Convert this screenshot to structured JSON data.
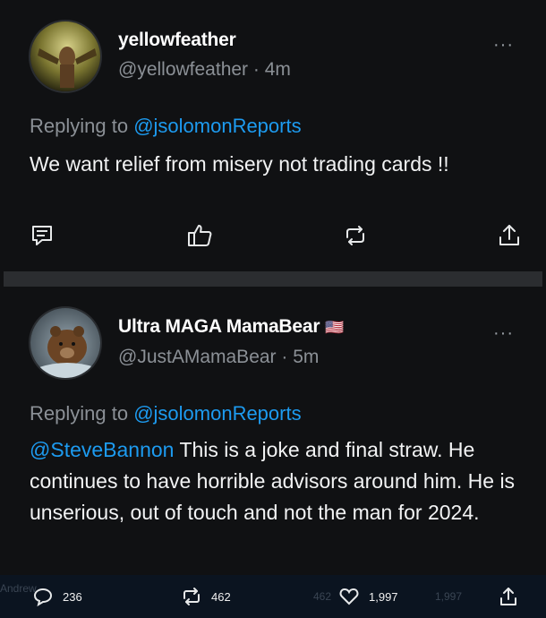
{
  "post1": {
    "name": "yellowfeather",
    "handle": "@yellowfeather",
    "time": "· 4m",
    "more": "···",
    "replying_prefix": "Replying to ",
    "replying_to": "@jsolomonReports",
    "text": "We want relief from misery not trading cards !!"
  },
  "post2": {
    "name": "Ultra MAGA MamaBear",
    "flag": "🇺🇸",
    "handle": "@JustAMamaBear",
    "time": "· 5m",
    "more": "···",
    "replying_prefix": "Replying to ",
    "replying_to": "@jsolomonReports",
    "text_mention": "@SteveBannon",
    "text": " This is a joke and final straw. He continues to have horrible advisors around him. He is unserious, out of touch and not the man for 2024."
  },
  "bottom_bar": {
    "replies": "236",
    "retweets": "462",
    "likes": "1,997",
    "ghost_retweets": "462",
    "ghost_likes": "1,997",
    "ghost_name": "Andrew"
  },
  "icons": {
    "reply": "chat-bubble-icon",
    "like": "thumbs-up-icon",
    "retweet": "retweet-icon",
    "share": "share-icon"
  },
  "colors": {
    "background": "#101113",
    "link": "#1d9bf0",
    "muted": "#8b9096"
  }
}
